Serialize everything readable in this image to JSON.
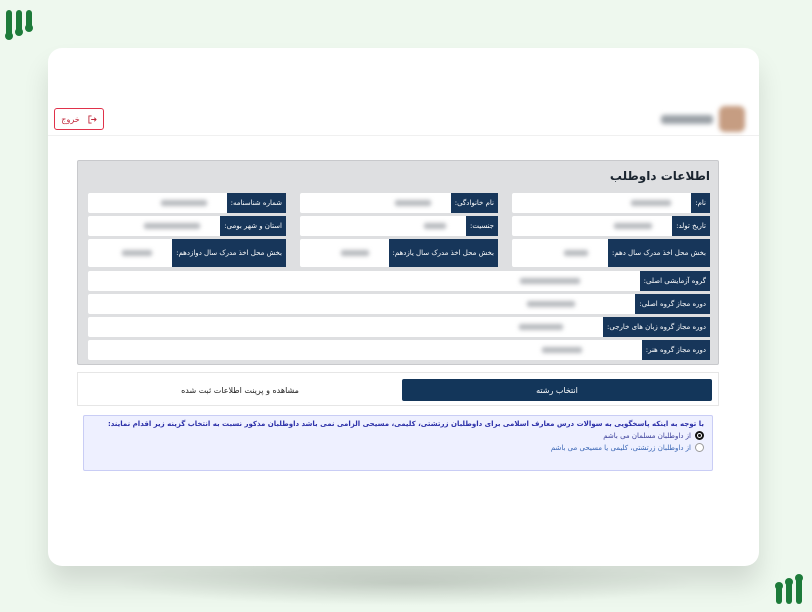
{
  "header": {
    "exit_label": "خروج"
  },
  "panel": {
    "title": "اطلاعات داوطلب",
    "labels": {
      "first_name": "نام:",
      "last_name": "نام خانوادگی:",
      "id_number": "شماره شناسنامه:",
      "birth_date": "تاریخ تولد:",
      "gender": "جنسیت:",
      "province_city": "استان و شهر بومی:",
      "grade10_region": "بخش محل اخذ مدرک سال دهم:",
      "grade11_region": "بخش محل اخذ مدرک سال یازدهم:",
      "grade12_region": "بخش محل اخذ مدرک سال دوازدهم:",
      "main_group": "گروه آزمایشی اصلی:",
      "main_group_period": "دوره مجاز گروه اصلی:",
      "foreign_lang_period": "دوره مجاز گروه زبان های خارجی:",
      "art_period": "دوره مجاز گروه هنر:"
    }
  },
  "actions": {
    "select_major": "انتخاب رشته",
    "view_print": "مشاهده و پرینت اطلاعات ثبت شده"
  },
  "notice": {
    "text": "با توجه به اینکه پاسخگویی به سوالات درس معارف اسلامی برای داوطلبان زرتشتی، کلیمی، مسیحی الزامی نمی باشد داوطلبان مذکور نسبت به انتخاب گزینه زیر اقدام نمایند:",
    "option1": "از داوطلبان مسلمان می باشم",
    "option2": "از داوطلبان زرتشتی، کلیمی یا مسیحی می باشم",
    "selected": "option1"
  },
  "colors": {
    "label_bg": "#17365a",
    "primary_btn": "#13365a",
    "exit_border": "#e0324a",
    "brand_green": "#1d7b3a",
    "notice_text": "#2b2fa8"
  }
}
